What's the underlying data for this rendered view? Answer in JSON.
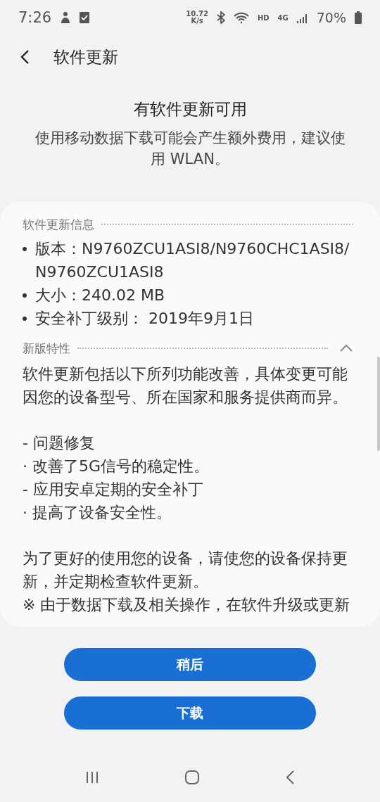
{
  "status_bar": {
    "time": "7:26",
    "speed_value": "10.72",
    "speed_unit": "K/s",
    "hd": "HD",
    "network": "4G",
    "battery": "70%"
  },
  "header": {
    "title": "软件更新"
  },
  "notice": {
    "title": "有软件更新可用",
    "message": "使用移动数据下载可能会产生额外费用，建议使用 WLAN。"
  },
  "info_section": {
    "title": "软件更新信息",
    "items": [
      "版本：N9760ZCU1ASI8/N9760CHC1ASI8/N9760ZCU1ASI8",
      "大小：240.02 MB",
      "安全补丁级别： 2019年9月1日"
    ]
  },
  "features_section": {
    "title": "新版特性",
    "expanded": true,
    "blocks": [
      {
        "kind": "paragraph",
        "text": "软件更新包括以下所列功能改善，具体变更可能因您的设备型号、所在国家和服务提供商而异。"
      },
      {
        "kind": "gap"
      },
      {
        "kind": "paragraph",
        "text": "- 问题修复"
      },
      {
        "kind": "paragraph",
        "text": "· 改善了5G信号的稳定性。"
      },
      {
        "kind": "paragraph",
        "text": "- 应用安卓定期的安全补丁"
      },
      {
        "kind": "paragraph",
        "text": "· 提高了设备安全性。"
      },
      {
        "kind": "gap"
      },
      {
        "kind": "paragraph",
        "text": "为了更好的使用您的设备，请使您的设备保持更新，并定期检查软件更新。"
      },
      {
        "kind": "paragraph",
        "text": "※ 由于数据下载及相关操作，在软件升级或更新"
      }
    ]
  },
  "buttons": [
    "稍后",
    "下载"
  ]
}
